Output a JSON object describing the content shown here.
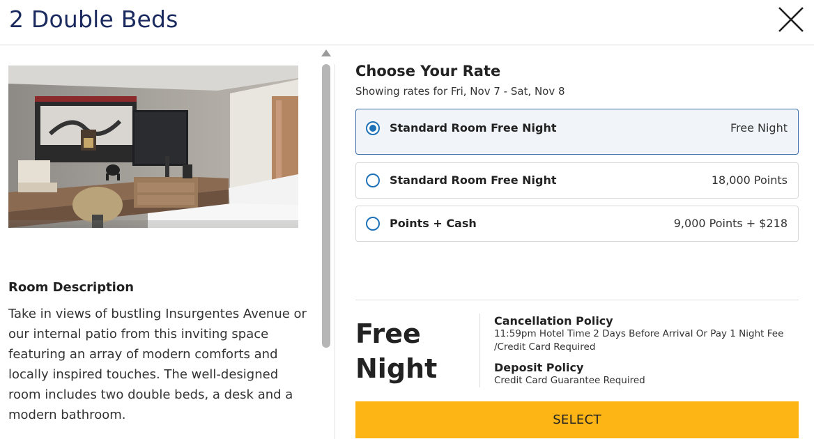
{
  "header": {
    "title": "2 Double Beds"
  },
  "room": {
    "description_title": "Room Description",
    "description_text": "Take in views of bustling Insurgentes Avenue or our internal patio from this inviting space featuring an array of modern comforts and locally inspired touches. The well-designed room includes two double beds, a desk and a modern bathroom."
  },
  "rates": {
    "title": "Choose Your Rate",
    "subtitle": "Showing rates for Fri, Nov 7 - Sat, Nov 8",
    "options": [
      {
        "name": "Standard Room Free Night",
        "price": "Free Night",
        "selected": true
      },
      {
        "name": "Standard Room Free Night",
        "price": "18,000 Points",
        "selected": false
      },
      {
        "name": "Points + Cash",
        "price": "9,000 Points + $218",
        "selected": false
      }
    ]
  },
  "summary": {
    "price_line1": "Free",
    "price_line2": "Night",
    "cancellation_title": "Cancellation Policy",
    "cancellation_text": "11:59pm Hotel Time 2 Days Before Arrival Or Pay 1 Night Fee /Credit Card Required",
    "deposit_title": "Deposit Policy",
    "deposit_text": "Credit Card Guarantee Required",
    "select_label": "SELECT"
  },
  "colors": {
    "title": "#1b2a5e",
    "accent_blue": "#1f72b8",
    "select_button": "#fdb515"
  },
  "icons": {
    "close": "close-icon",
    "scroll_up": "scroll-up-arrow-icon"
  }
}
